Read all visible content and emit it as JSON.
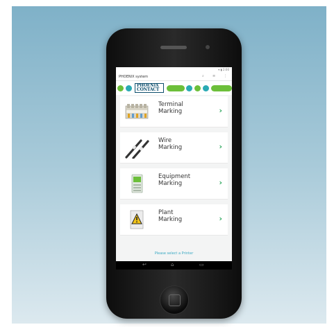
{
  "status_bar": {
    "icons_text": "▾ ▮ 2:00"
  },
  "app_bar": {
    "title": "PHOENIX system",
    "icons": [
      "search-icon",
      "list-icon",
      "overflow-menu-icon"
    ]
  },
  "brand": {
    "logo_line1": "PHOENIX",
    "logo_line2": "CONTACT",
    "colors": {
      "green": "#6cbf3a",
      "teal": "#2aaab4",
      "navy": "#0d4e6d"
    }
  },
  "menu": {
    "items": [
      {
        "line1": "Terminal",
        "line2": "Marking",
        "icon": "terminal-block-icon"
      },
      {
        "line1": "Wire",
        "line2": "Marking",
        "icon": "wire-marker-icon"
      },
      {
        "line1": "Equipment",
        "line2": "Marking",
        "icon": "equipment-device-icon"
      },
      {
        "line1": "Plant",
        "line2": "Marking",
        "icon": "warning-sign-icon"
      }
    ],
    "chevron": "›",
    "accent_color": "#2aa55a"
  },
  "footer": {
    "prompt": "Please select a Printer"
  },
  "nav_bar": {
    "back": "↩",
    "home": "⌂",
    "recents": "▭"
  }
}
